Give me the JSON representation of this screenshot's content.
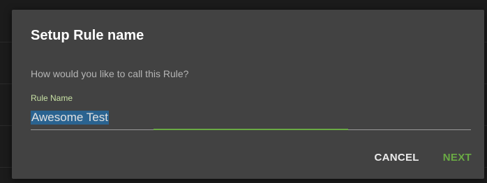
{
  "dialog": {
    "title": "Setup Rule name",
    "prompt": "How would you like to call this Rule?",
    "field": {
      "label": "Rule Name",
      "value": "Awesome Test"
    },
    "actions": {
      "cancel_label": "CANCEL",
      "next_label": "NEXT"
    }
  },
  "colors": {
    "dialog_background": "#424242",
    "accent_green": "#6aaa44",
    "selection_blue": "#2a6390"
  }
}
